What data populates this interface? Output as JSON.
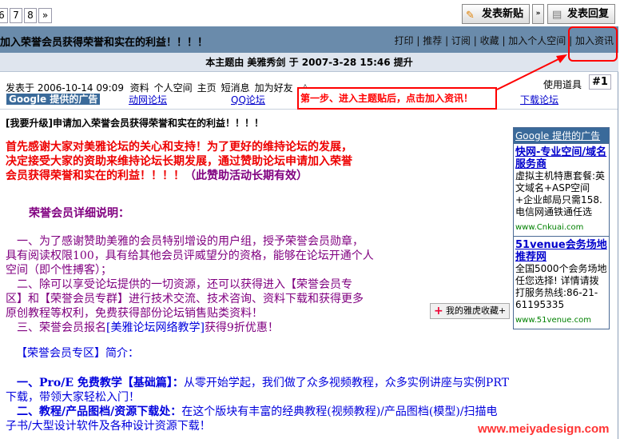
{
  "pagination": {
    "pages": [
      "6",
      "7",
      "8"
    ],
    "next": "»"
  },
  "toolbar": {
    "new_post": "发表新贴",
    "reply": "发表回复",
    "dropdown": "»"
  },
  "thread": {
    "title": "加入荣誉会员获得荣誉和实在的利益！！！！",
    "actions": [
      "打印",
      "推荐",
      "订阅",
      "收藏",
      "加入个人空间",
      "加入资讯"
    ],
    "bumped": "本主题由 美雅秀剑 于 2007-3-28 15:46 提升"
  },
  "post": {
    "meta": "发表于 2006-10-14 09:09",
    "links": [
      "资料",
      "个人空间",
      "主页",
      "短消息",
      "加为好友"
    ],
    "tools": "使用道具",
    "floor": "#1",
    "ad_label": "Google 提供的广告",
    "ad_links": [
      "动网论坛",
      "QQ论坛",
      "下载论坛"
    ],
    "subject": "[我要升级]申请加入荣誉会员获得荣誉和实在的利益！！！！",
    "intro": [
      "首先感谢大家对美雅论坛的关心和支持！为了更好的维持论坛的发展，",
      "决定接受大家的资助来维持论坛长期发展，通过赞助论坛申请加入荣誉",
      "会员获得荣誉和实在的利益！！！！"
    ],
    "intro_note": "（此赞助活动长期有效）",
    "detail_title": "荣誉会员详细说明：",
    "detail": [
      "　一、为了感谢赞助美雅的会员特别增设的用户组，授予荣誉会员勋章，",
      "具有阅读权限100，具有给其他会员评威望分的资格，能够在论坛开通个人",
      "空间（即个性搏客）；",
      "　二、除可以享受论坛提供的一切资源，还可以获得进入【荣誉会员专",
      "区】和【荣誉会员专群】进行技术交流、技术咨询、资料下载和获得更多",
      "原创教程等权利，免费获得部份论坛销售贴类资料！"
    ],
    "detail3_pre": "　三、荣誉会员报名",
    "detail3_link": "[美雅论坛网络教学]",
    "detail3_post": "获得9折优惠！",
    "zone_title": "【荣誉会员专区】简介：",
    "zone1_head": "　一、Pro/E 免费教学【基础篇】：",
    "zone1_text": "从零开始学起，我们做了众多视频教程，众多实例讲座与实例PRT",
    "zone1_text2": "下载，带领大家轻松入门！",
    "zone2_head": "　二、教程/产品图档/资源下载处：",
    "zone2_text": "在这个版块有丰富的经典教程(视频教程)/产品图档(模型)/扫描电",
    "zone2_text2": "子书/大型设计软件及各种设计资源下载！"
  },
  "side_ad": {
    "header": "Google 提供的广告",
    "items": [
      {
        "title": "快网-专业空间/域名服务商",
        "desc": "虚拟主机特惠套餐:英文域名+ASP空间 +企业邮局只需158.电信网通铁通任选",
        "url": "www.Cnkuai.com"
      },
      {
        "title": "51venue会务场地推荐网",
        "desc": "全国5000个会务场地任您选择! 详情请拨打服务热线:86-21-61195335",
        "url": "www.51venue.com"
      }
    ]
  },
  "yahoo": "我的雅虎收藏+",
  "annotation": "第一步、进入主题贴后，点击加入资讯！",
  "watermark": "www.meiyadesign.com",
  "colors": {
    "header": "#6a8bab",
    "annotation": "#ff0000"
  }
}
